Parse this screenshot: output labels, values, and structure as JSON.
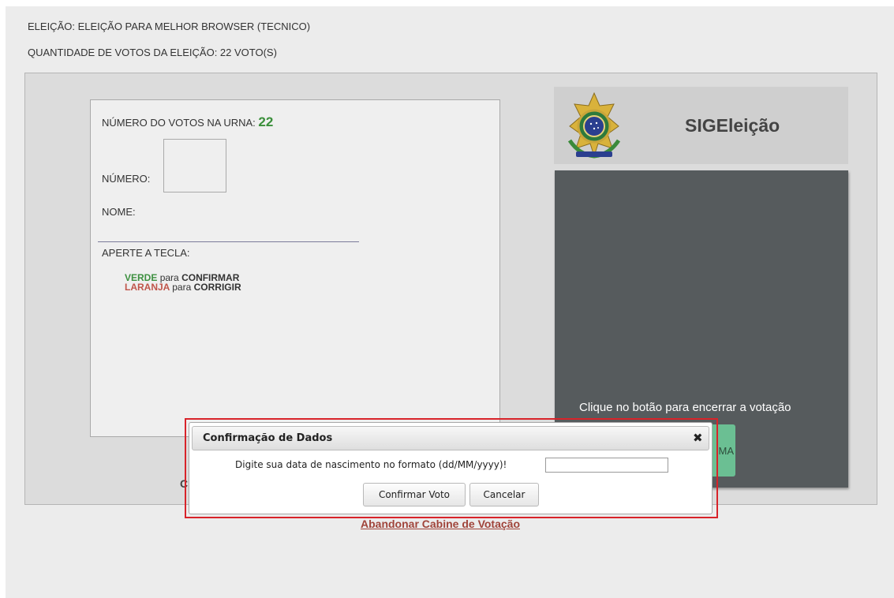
{
  "header": {
    "election_line": "ELEIÇÃO: ELEIÇÃO PARA MELHOR BROWSER (TECNICO)",
    "votes_line": "QUANTIDADE DE VOTOS DA ELEIÇÃO: 22 VOTO(S)"
  },
  "ballot": {
    "votes_in_urn_label": "NÚMERO DO VOTOS NA URNA:",
    "votes_in_urn_value": "22",
    "number_label": "NÚMERO:",
    "name_label": "NOME:",
    "press_key_label": "APERTE A TECLA:",
    "green_word": "VERDE",
    "confirm_middle": "para",
    "confirm_word": "CONFIRMAR",
    "orange_word": "LARANJA",
    "correct_middle": "para",
    "correct_word": "CORRIGIR",
    "partial_hidden_text": "C"
  },
  "brand": {
    "title": "SIGEleição",
    "logo_icon": "brazil-coat-of-arms-icon"
  },
  "side_panel": {
    "instruction": "Clique no botão para encerrar a votação",
    "button_partial_label": "MA"
  },
  "links": {
    "abandon": "Abandonar Cabine de Votação"
  },
  "dialog": {
    "title": "Confirmação de Dados",
    "prompt": "Digite sua data de nascimento no formato (dd/MM/yyyy)!",
    "input_value": "",
    "confirm_label": "Confirmar Voto",
    "cancel_label": "Cancelar"
  },
  "colors": {
    "accent_green": "#3d9040",
    "accent_orange": "#c0554a",
    "highlight_red": "#d8232a",
    "dark_panel": "#565b5d"
  }
}
